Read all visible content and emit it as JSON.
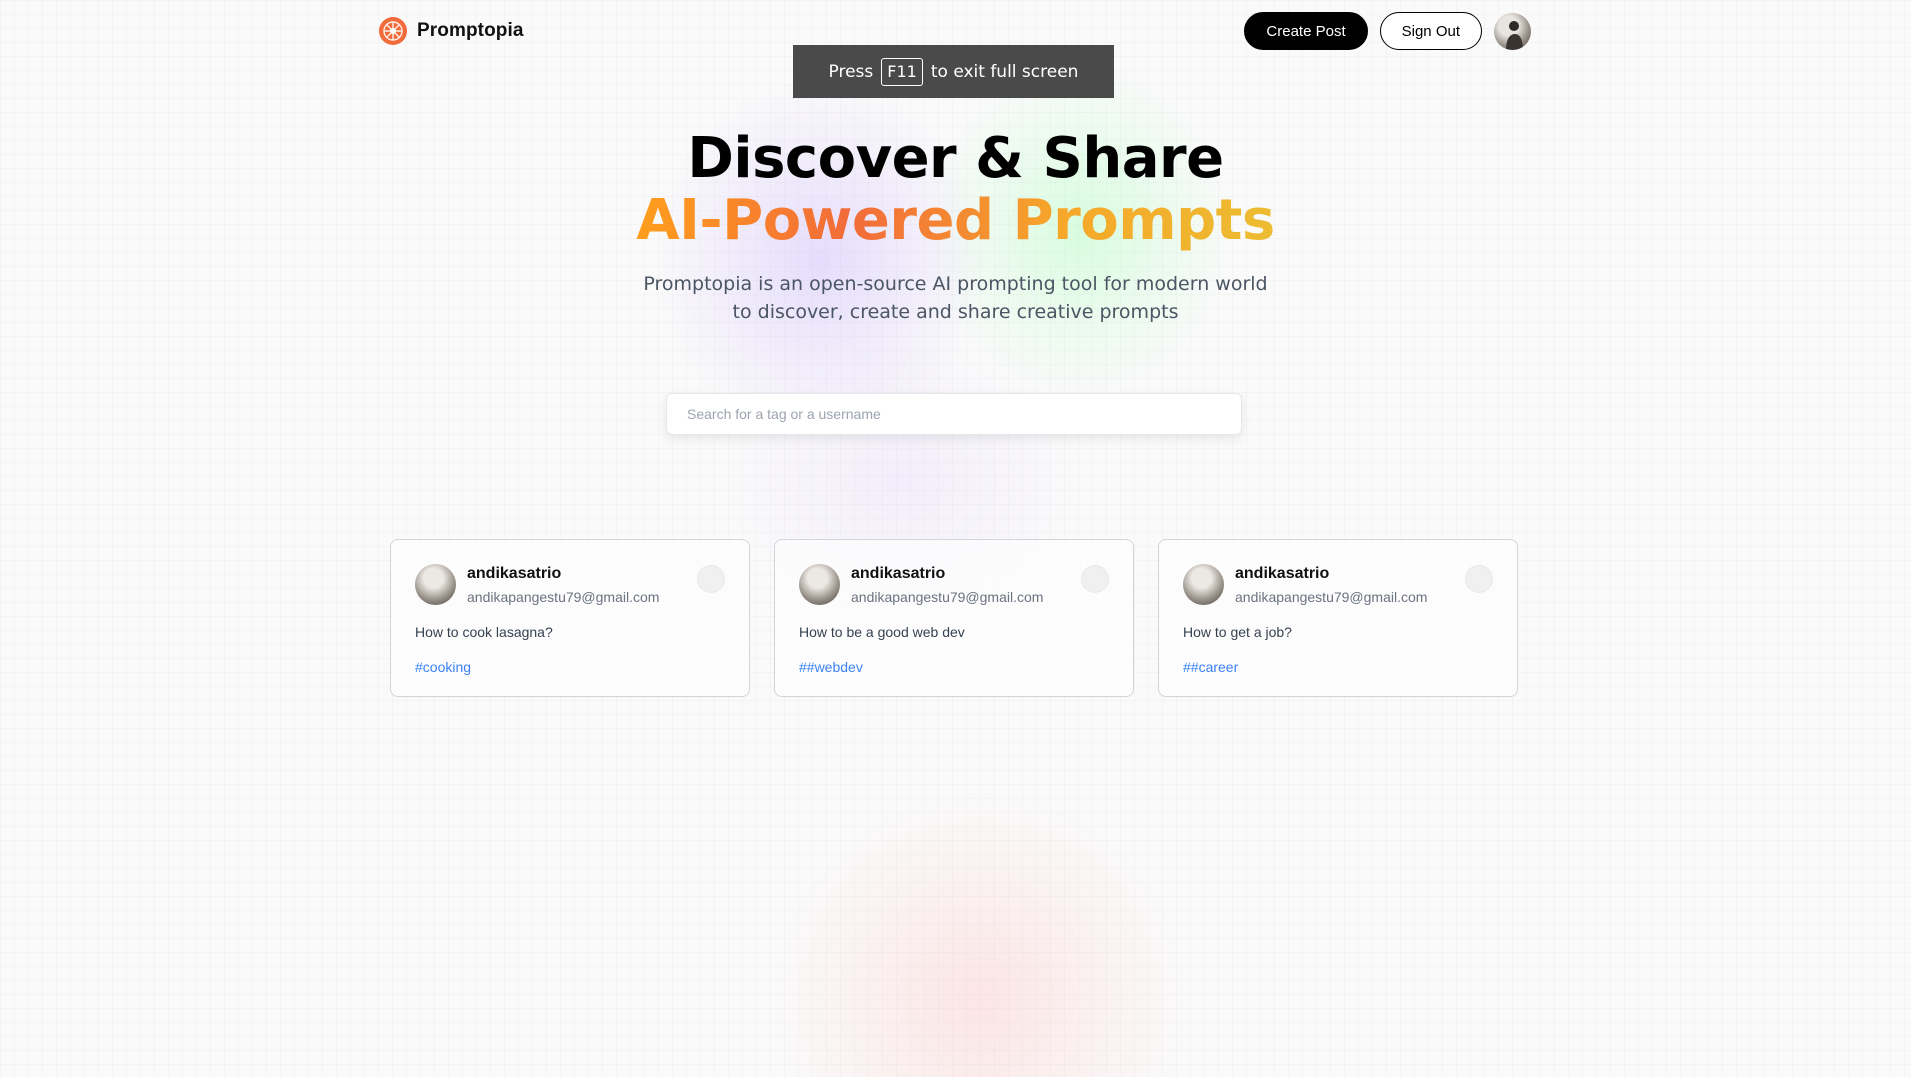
{
  "nav": {
    "brand": "Promptopia",
    "create_post": "Create Post",
    "sign_out": "Sign Out"
  },
  "fullscreen_toast": {
    "press": "Press",
    "key": "F11",
    "rest": "to exit full screen"
  },
  "hero": {
    "title_line1": "Discover & Share",
    "title_line2": "AI-Powered Prompts",
    "description": "Promptopia is an open-source AI prompting tool for modern world to discover, create and share creative prompts"
  },
  "search": {
    "placeholder": "Search for a tag or a username",
    "value": ""
  },
  "posts": [
    {
      "username": "andikasatrio",
      "email": "andikapangestu79@gmail.com",
      "prompt": "How to cook lasagna?",
      "tag": "#cooking"
    },
    {
      "username": "andikasatrio",
      "email": "andikapangestu79@gmail.com",
      "prompt": "How to be a good web dev",
      "tag": "##webdev"
    },
    {
      "username": "andikasatrio",
      "email": "andikapangestu79@gmail.com",
      "prompt": "How to get a job?",
      "tag": "##career"
    }
  ],
  "colors": {
    "brand_orange": "#f26b3a",
    "gradient_start": "#ff9f1c",
    "gradient_end": "#ecbc31",
    "tag_blue": "#3b82f6"
  },
  "icons": {
    "logo": "promptopia-logo-icon",
    "copy": "copy-icon"
  }
}
